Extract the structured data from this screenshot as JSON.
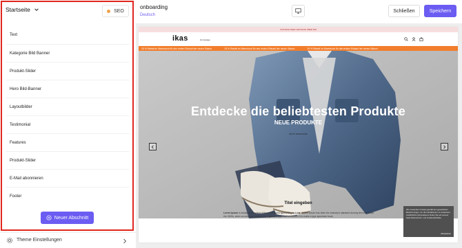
{
  "left_panel": {
    "page_selector": "Startseite",
    "seo_label": "SEO",
    "sections": [
      {
        "label": "Text"
      },
      {
        "label": "Kategorie Bild Banner"
      },
      {
        "label": "Produkt-Slider"
      },
      {
        "label": "Hero Bild-Banner"
      },
      {
        "label": "Layoutbilder"
      },
      {
        "label": "Testimonial"
      },
      {
        "label": "Features"
      },
      {
        "label": "Produkt-Slider"
      },
      {
        "label": "E-Mail abonnieren"
      },
      {
        "label": "Footer"
      }
    ],
    "add_section_label": "Neuer Abschnitt",
    "theme_settings_label": "Theme Einstellungen"
  },
  "topbar": {
    "store_name": "onboarding",
    "language": "Deutsch",
    "close_label": "Schließen",
    "save_label": "Speichern"
  },
  "preview": {
    "announcement": "KOSTENLOSER VERSAND ÜBER 50€",
    "logo": "ikas",
    "nav_link": "Homepage",
    "marquee_text": "15 % Rabatt im Warenkorb für den ersten Einkauf der neuen Saison",
    "hero_title": "Entdecke die beliebtesten Produkte",
    "hero_subtitle": "NEUE PRODUKTE",
    "hero_cta": "JETZT EINKAUFEN",
    "section_title": "Titel eingeben",
    "body_lead": "Lorem Ipsum",
    "body_text": " is simply dummy text of the printing and typesetting industry. Lorem Ipsum has been the industry's standard dummy text ever since the 1500s, when an unknown printer took a galley of type and scrambled it to make a type specimen book.",
    "cookie_text": "Wir verwenden Cookies gemäß den gesetzlichen Bestimmungen, um die Interaktionen zu verbessern. Ausführliche Informationen finden Sie auf unserer Seite Datenschutz- und Cookie-Richtlinie.",
    "cookie_accept": "Akzeptieren"
  },
  "colors": {
    "accent": "#6b5cf2",
    "highlight_border": "#e0261d",
    "seo_status": "#f0a04a",
    "marquee": "#f27d2b"
  },
  "icons": [
    "chevron-down-icon",
    "plus-circle-icon",
    "gear-icon",
    "chevron-right-icon",
    "desktop-icon",
    "search-icon",
    "user-icon",
    "bag-icon",
    "arrow-left-icon",
    "arrow-right-icon"
  ]
}
